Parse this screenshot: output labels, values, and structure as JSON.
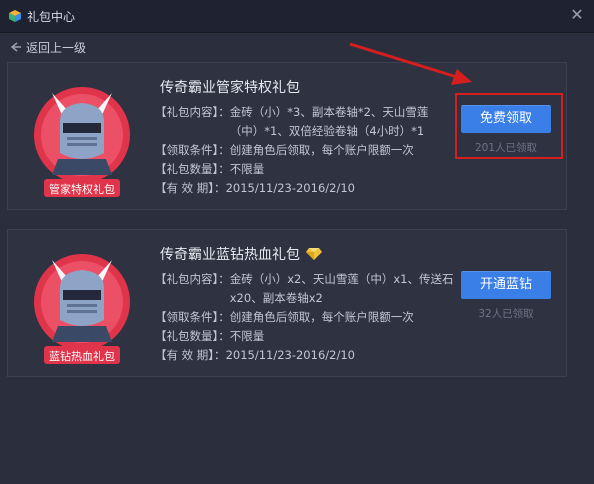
{
  "window": {
    "title": "礼包中心",
    "close": "✕"
  },
  "nav": {
    "back_label": "返回上一级"
  },
  "gifts": [
    {
      "title": "传奇霸业管家特权礼包",
      "badge": "管家特权礼包",
      "rows": [
        {
          "label": "【礼包内容】：",
          "value": "金砖（小）*3、副本卷轴*2、天山雪莲（中）*1、双倍经验卷轴（4小时）*1"
        },
        {
          "label": "【领取条件】：",
          "value": "创建角色后领取，每个账户限额一次"
        },
        {
          "label": "【礼包数量】：",
          "value": "不限量"
        },
        {
          "label": "【有 效 期】：",
          "value": "2015/11/23-2016/2/10"
        }
      ],
      "button": "免费领取",
      "claimed": "201人已领取"
    },
    {
      "title": "传奇霸业蓝钻热血礼包",
      "badge": "蓝钻热血礼包",
      "rows": [
        {
          "label": "【礼包内容】：",
          "value": "金砖（小）x2、天山雪莲（中）x1、传送石x20、副本卷轴x2"
        },
        {
          "label": "【领取条件】：",
          "value": "创建角色后领取，每个账户限额一次"
        },
        {
          "label": "【礼包数量】：",
          "value": "不限量"
        },
        {
          "label": "【有 效 期】：",
          "value": "2015/11/23-2016/2/10"
        }
      ],
      "button": "开通蓝钻",
      "claimed": "32人已领取"
    }
  ],
  "colors": {
    "background": "#2b2f3d",
    "button": "#3a7ee8",
    "badge": "#e0344a",
    "annotation": "#d51e1e"
  },
  "icons": {
    "app": "gift-cube-icon",
    "back": "arrow-left-icon",
    "close": "close-icon",
    "diamond": "blue-diamond-icon"
  }
}
